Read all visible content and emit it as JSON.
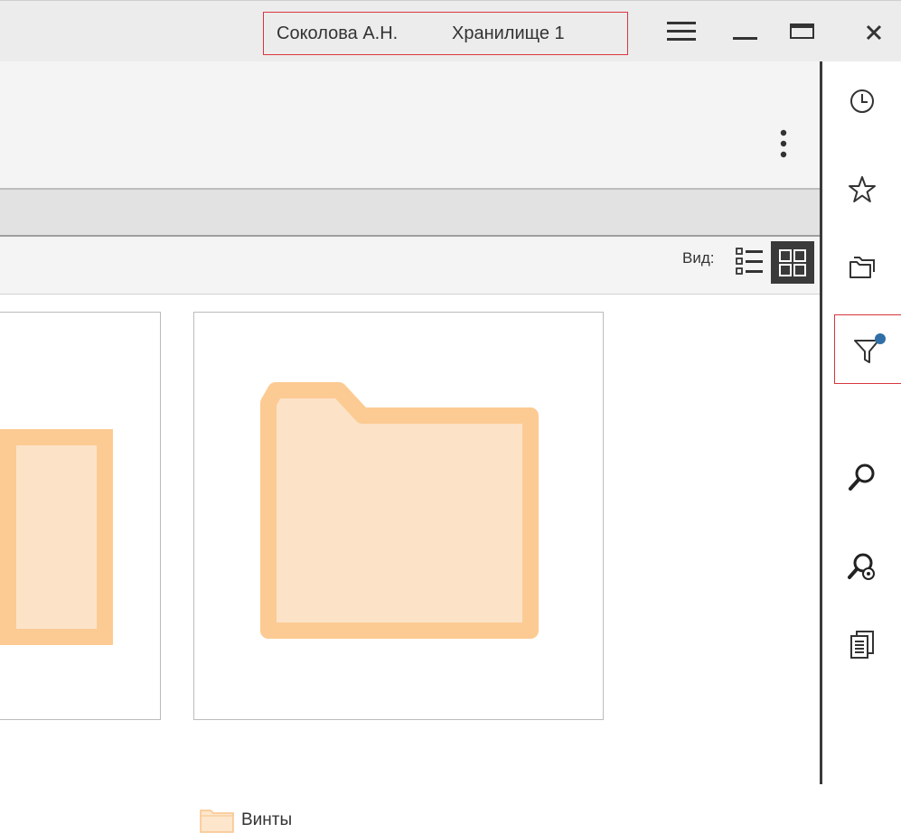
{
  "titlebar": {
    "user_name": "Соколова А.Н.",
    "storage_name": "Хранилище 1",
    "buttons": [
      "menu-icon",
      "minimize-icon",
      "maximize-icon",
      "close-icon"
    ]
  },
  "toolbar": {
    "view_label": "Вид:",
    "view_modes": [
      "list-view-icon",
      "grid-view-icon"
    ],
    "active_view": "grid"
  },
  "content": {
    "items": [
      {
        "name": "",
        "type": "folder",
        "partially_visible": true
      },
      {
        "name": "Винты",
        "type": "folder"
      }
    ]
  },
  "sidebar": {
    "items": [
      {
        "icon": "history-clock-icon"
      },
      {
        "icon": "favorites-star-icon"
      },
      {
        "icon": "folders-icon"
      },
      {
        "icon": "filter-icon",
        "active": true,
        "badge": true
      },
      {
        "icon": "search-icon"
      },
      {
        "icon": "advanced-search-icon"
      },
      {
        "icon": "documents-icon"
      }
    ]
  },
  "colors": {
    "folder_fill": "#fce3c8",
    "folder_border": "#fccb93",
    "accent_red": "#d9363e",
    "filter_badge": "#2f6fa6",
    "active_view_bg": "#3a3a3a"
  }
}
